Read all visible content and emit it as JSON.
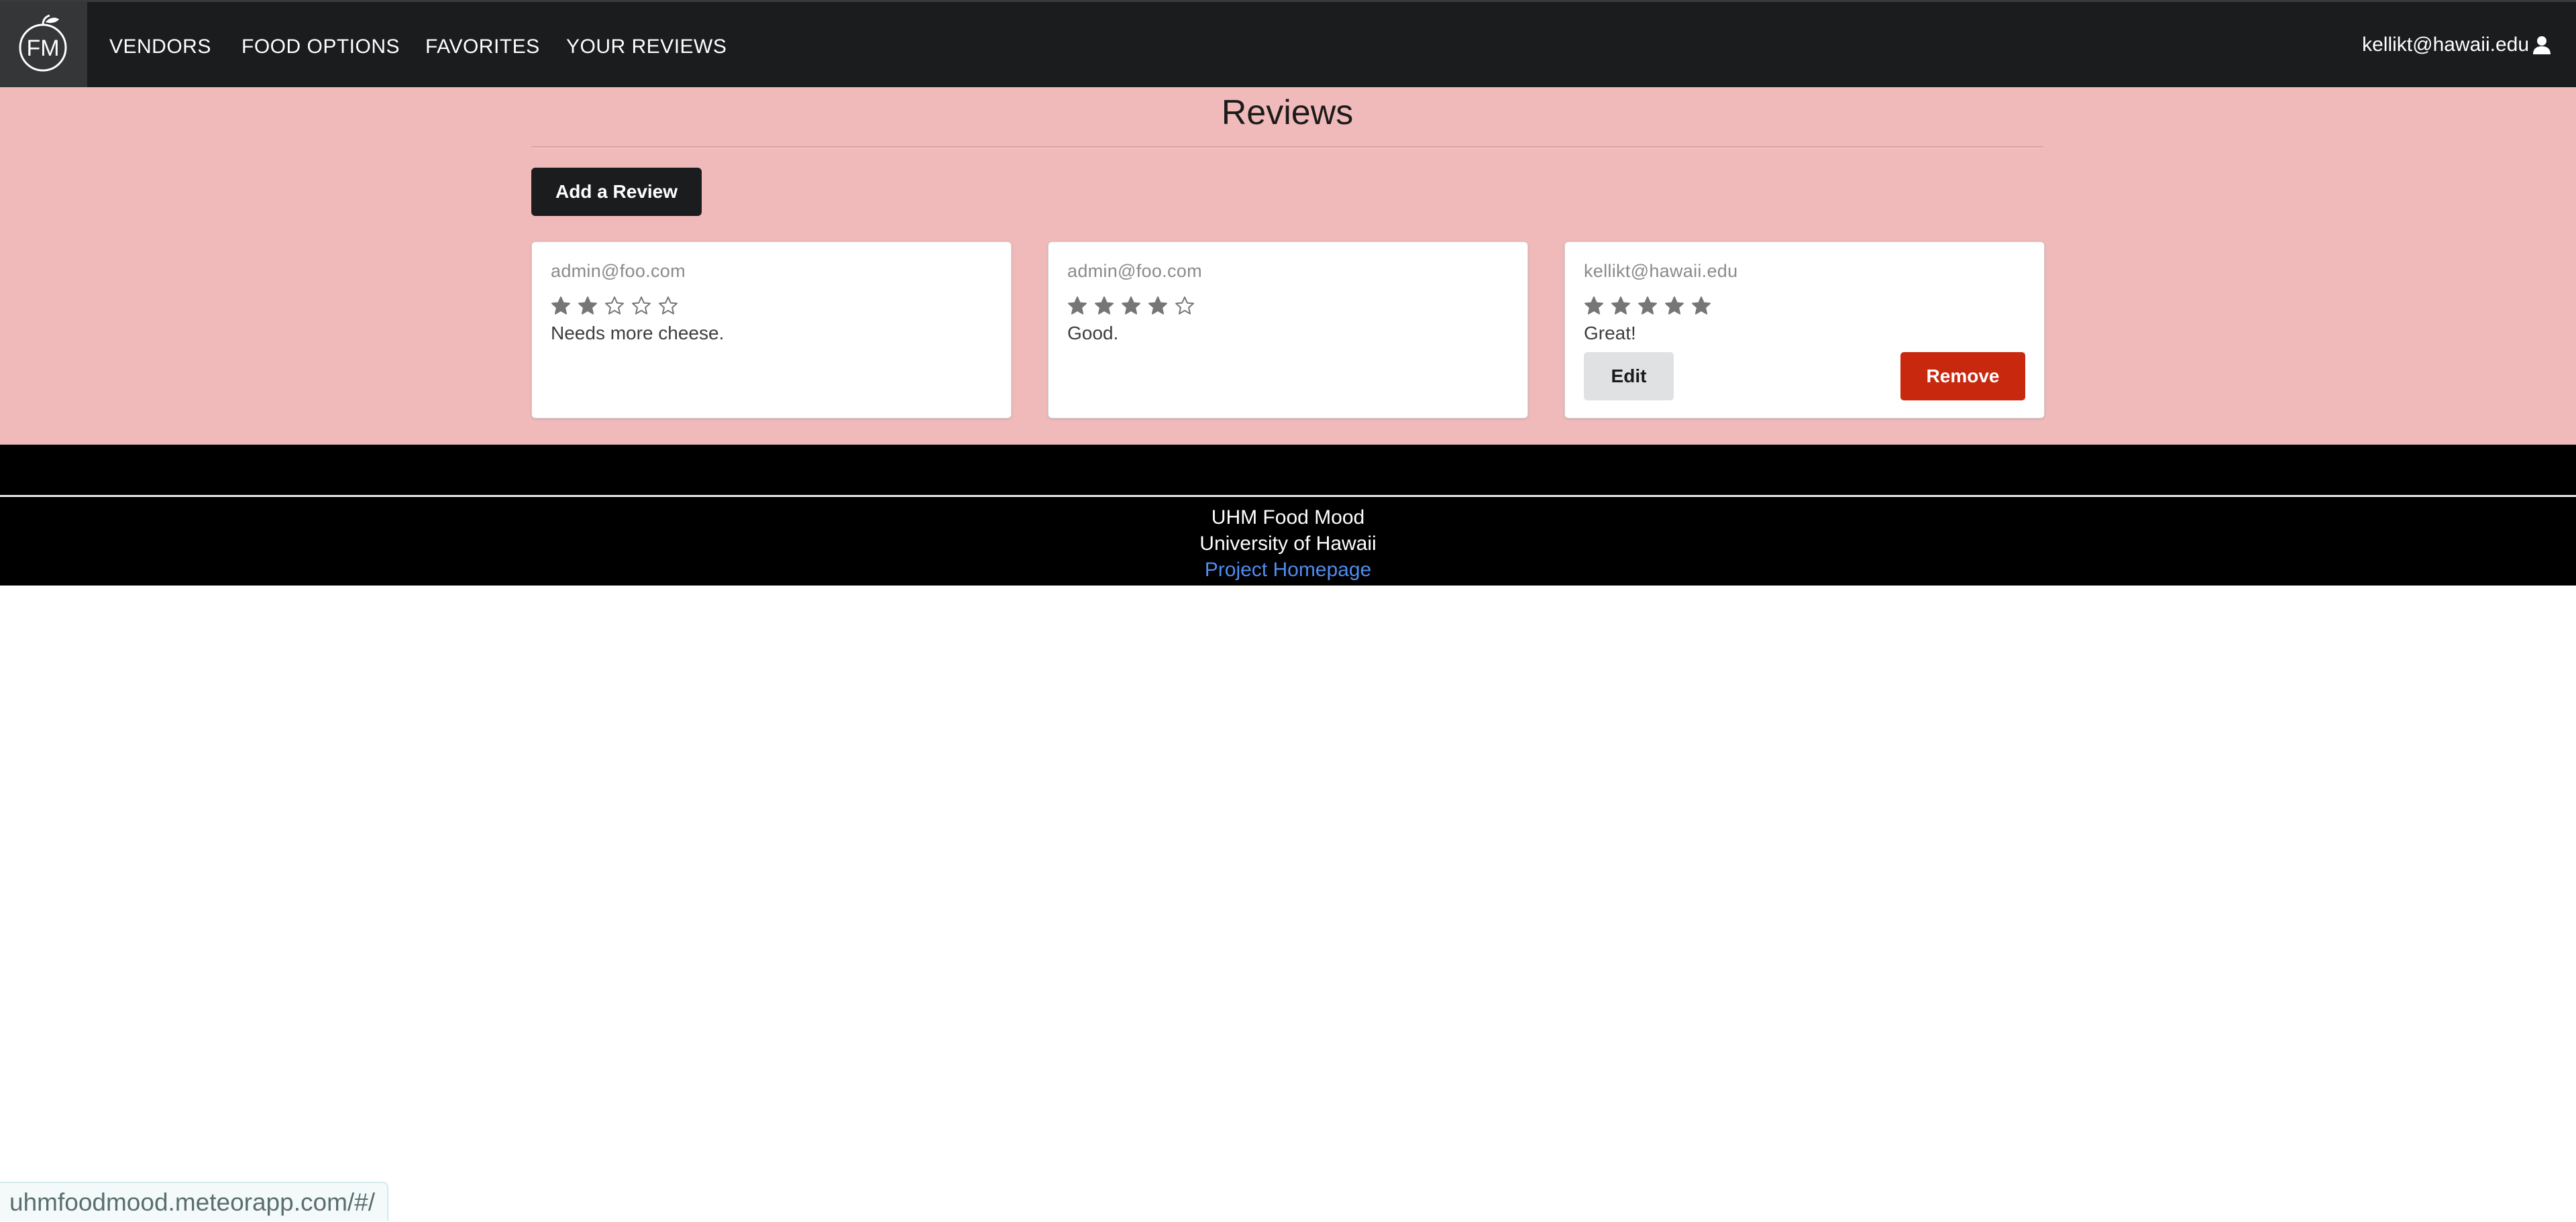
{
  "nav": {
    "logo_text": "FM",
    "items": [
      {
        "label": "VENDORS"
      },
      {
        "label": "FOOD OPTIONS"
      },
      {
        "label": "FAVORITES"
      },
      {
        "label": "YOUR REVIEWS"
      }
    ],
    "user_email": "kellikt@hawaii.edu",
    "user_icon": "user-icon"
  },
  "main": {
    "title": "Reviews",
    "add_button_label": "Add a Review",
    "background_color": "#f1baba"
  },
  "reviews": [
    {
      "author": "admin@foo.com",
      "rating": 2,
      "max_rating": 5,
      "text": "Needs more cheese."
    },
    {
      "author": "admin@foo.com",
      "rating": 4,
      "max_rating": 5,
      "text": "Good."
    },
    {
      "author": "kellikt@hawaii.edu",
      "rating": 5,
      "max_rating": 5,
      "text": "Great!",
      "edit_label": "Edit",
      "remove_label": "Remove"
    }
  ],
  "footer": {
    "line1": "UHM Food Mood",
    "line2": "University of Hawaii",
    "link_label": "Project Homepage"
  },
  "status_bar": {
    "url": "uhmfoodmood.meteorapp.com/#/"
  }
}
